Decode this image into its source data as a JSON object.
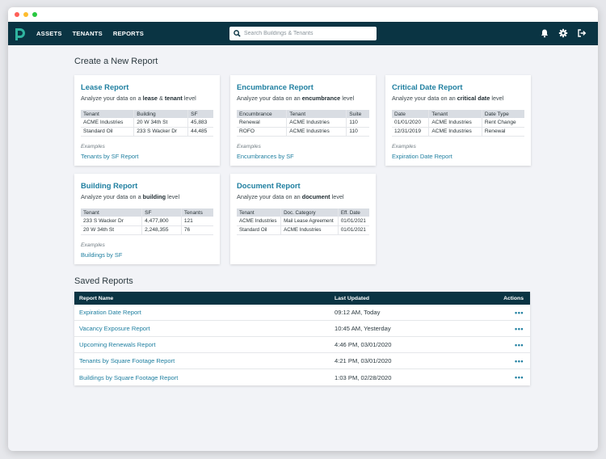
{
  "colors": {
    "nav_bg": "#0a3443",
    "accent": "#1f7fa0",
    "close": "#ff5f57",
    "min": "#febc2e",
    "max": "#28c840"
  },
  "nav": {
    "items": [
      "ASSETS",
      "TENANTS",
      "REPORTS"
    ],
    "search_placeholder": "Search Buildings & Tenants",
    "icons": [
      "bell-icon",
      "gear-icon",
      "logout-icon"
    ]
  },
  "create": {
    "title": "Create a New Report",
    "cards": [
      {
        "title": "Lease Report",
        "sub_pre": "Analyze your data on a ",
        "sub_b1": "lease",
        "sub_mid": " & ",
        "sub_b2": "tenant",
        "sub_post": " level",
        "headers": [
          "Tenant",
          "Building",
          "SF"
        ],
        "rows": [
          [
            "ACME Industries",
            "20 W 34th St",
            "45,883"
          ],
          [
            "Standard Oil",
            "233 S Wacker Dr",
            "44,485"
          ]
        ],
        "examples_label": "Examples",
        "example_link": "Tenants by SF Report"
      },
      {
        "title": "Encumbrance Report",
        "sub_pre": "Analyze your data on an ",
        "sub_b1": "encumbrance",
        "sub_post": " level",
        "headers": [
          "Encumbrance",
          "Tenant",
          "Suite"
        ],
        "rows": [
          [
            "Renewal",
            "ACME Industries",
            "110"
          ],
          [
            "ROFO",
            "ACME Industries",
            "110"
          ]
        ],
        "examples_label": "Examples",
        "example_link": "Encumbrances by SF"
      },
      {
        "title": "Critical Date Report",
        "sub_pre": "Analyze your data on an ",
        "sub_b1": "critical date",
        "sub_post": " level",
        "headers": [
          "Date",
          "Tenant",
          "Date Type"
        ],
        "rows": [
          [
            "01/01/2020",
            "ACME Industries",
            "Rent Change"
          ],
          [
            "12/31/2019",
            "ACME Industries",
            "Renewal"
          ]
        ],
        "examples_label": "Examples",
        "example_link": "Expiration Date Report"
      },
      {
        "title": "Building Report",
        "sub_pre": "Analyze your data on a ",
        "sub_b1": "building",
        "sub_post": " level",
        "headers": [
          "Tenant",
          "SF",
          "Tenants"
        ],
        "rows": [
          [
            "233 S Wacker Dr",
            "4,477,800",
            "121"
          ],
          [
            "20 W 34th St",
            "2,248,355",
            "76"
          ]
        ],
        "examples_label": "Examples",
        "example_link": "Buildings by SF"
      },
      {
        "title": "Document Report",
        "sub_pre": "Analyze your data on an ",
        "sub_b1": "document",
        "sub_post": " level",
        "headers": [
          "Tenant",
          "Doc. Category",
          "Eff. Date"
        ],
        "rows": [
          [
            "ACME Industries",
            "Mail Lease Agreement",
            "01/01/2021"
          ],
          [
            "Standard Oil",
            "ACME Industries",
            "01/01/2021"
          ]
        ]
      }
    ]
  },
  "saved": {
    "title": "Saved Reports",
    "headers": {
      "name": "Report Name",
      "updated": "Last Updated",
      "actions": "Actions"
    },
    "rows": [
      {
        "name": "Expiration Date Report",
        "updated": "09:12 AM, Today"
      },
      {
        "name": "Vacancy Exposure Report",
        "updated": "10:45 AM, Yesterday"
      },
      {
        "name": "Upcoming Renewals Report",
        "updated": "4:46 PM, 03/01/2020"
      },
      {
        "name": "Tenants by Square Footage Report",
        "updated": "4:21 PM, 03/01/2020"
      },
      {
        "name": "Buildings by Square Footage Report",
        "updated": "1:03 PM, 02/28/2020"
      }
    ],
    "actions_glyph": "•••"
  }
}
